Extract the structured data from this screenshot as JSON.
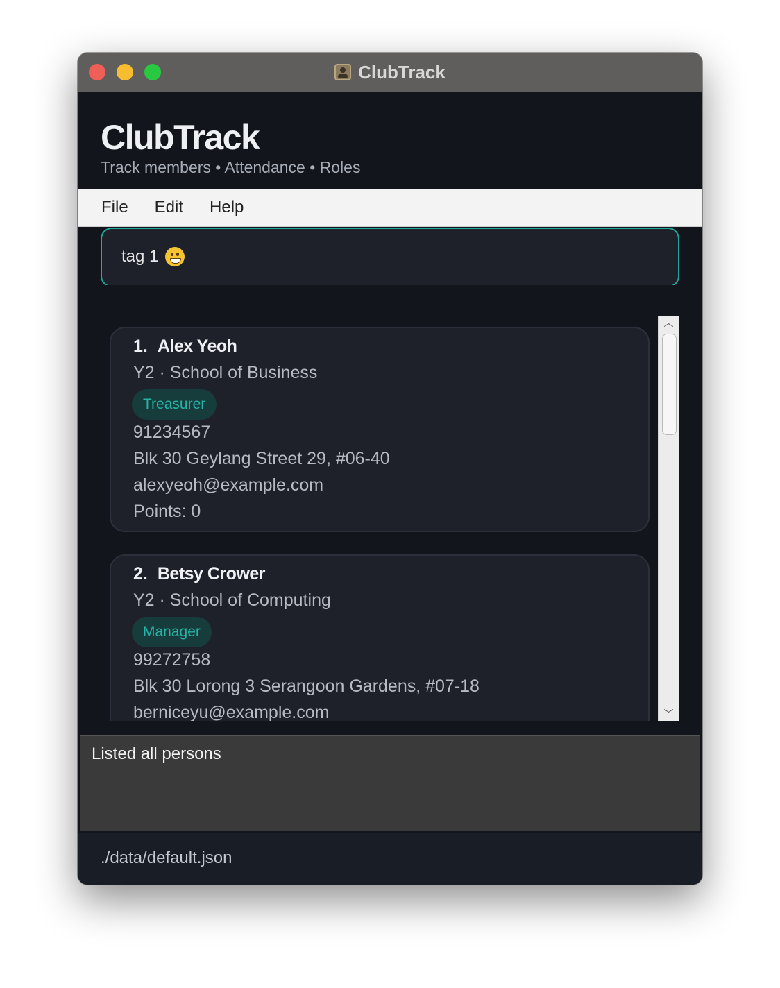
{
  "window": {
    "title": "ClubTrack"
  },
  "header": {
    "brand": "ClubTrack",
    "tagline": "Track members • Attendance • Roles"
  },
  "menu": {
    "items": [
      "File",
      "Edit",
      "Help"
    ]
  },
  "command": {
    "value": "tag 1",
    "emoji": "grinning-face-icon"
  },
  "persons": [
    {
      "index": "1.",
      "name": "Alex Yeoh",
      "year_school": "Y2 · School of Business",
      "tag": "Treasurer",
      "phone": "91234567",
      "address": "Blk 30 Geylang Street 29, #06-40",
      "email": "alexyeoh@example.com",
      "points": "Points: 0"
    },
    {
      "index": "2.",
      "name": "Betsy Crower",
      "year_school": "Y2 · School of Computing",
      "tag": "Manager",
      "phone": "99272758",
      "address": "Blk 30 Lorong 3 Serangoon Gardens, #07-18",
      "email": "berniceyu@example.com"
    }
  ],
  "result": {
    "message": "Listed all persons"
  },
  "status": {
    "file_path": "./data/default.json"
  },
  "colors": {
    "accent": "#1fa99d",
    "tag_text": "#27b3a6",
    "tag_bg": "#163c3c",
    "background": "#12151c",
    "card": "#1e212a"
  }
}
